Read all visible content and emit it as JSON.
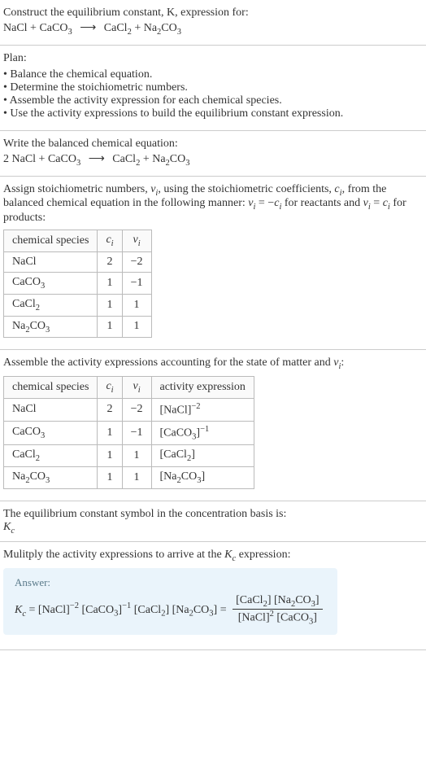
{
  "intro": {
    "line1": "Construct the equilibrium constant, K, expression for:",
    "eq_left": "NaCl + CaCO",
    "eq_left_sub": "3",
    "arrow": "⟶",
    "eq_right1": "CaCl",
    "eq_right1_sub": "2",
    "eq_plus": " + Na",
    "eq_right2_sub1": "2",
    "eq_right2": "CO",
    "eq_right2_sub2": "3"
  },
  "plan": {
    "header": "Plan:",
    "items": [
      "Balance the chemical equation.",
      "Determine the stoichiometric numbers.",
      "Assemble the activity expression for each chemical species.",
      "Use the activity expressions to build the equilibrium constant expression."
    ]
  },
  "balanced": {
    "header": "Write the balanced chemical equation:",
    "eq": "2 NaCl + CaCO3  ⟶  CaCl2 + Na2CO3"
  },
  "stoich_text": {
    "line1a": "Assign stoichiometric numbers, ν",
    "line1a_sub": "i",
    "line1b": ", using the stoichiometric coefficients, c",
    "line1b_sub": "i",
    "line1c": ", from the balanced chemical equation in the following manner: ν",
    "line1c_sub": "i",
    "line1d": " = −c",
    "line1d_sub": "i",
    "line1e": " for reactants and ν",
    "line1e_sub": "i",
    "line1f": " = c",
    "line1f_sub": "i",
    "line1g": " for products:"
  },
  "stoich_table": {
    "headers": [
      "chemical species",
      "cᵢ",
      "νᵢ"
    ],
    "rows": [
      {
        "species": "NaCl",
        "c": "2",
        "v": "−2"
      },
      {
        "species": "CaCO3",
        "c": "1",
        "v": "−1"
      },
      {
        "species": "CaCl2",
        "c": "1",
        "v": "1"
      },
      {
        "species": "Na2CO3",
        "c": "1",
        "v": "1"
      }
    ]
  },
  "activity_text": "Assemble the activity expressions accounting for the state of matter and νᵢ:",
  "activity_table": {
    "headers": [
      "chemical species",
      "cᵢ",
      "νᵢ",
      "activity expression"
    ],
    "rows": [
      {
        "species": "NaCl",
        "c": "2",
        "v": "−2",
        "expr": "[NaCl]^−2"
      },
      {
        "species": "CaCO3",
        "c": "1",
        "v": "−1",
        "expr": "[CaCO3]^−1"
      },
      {
        "species": "CaCl2",
        "c": "1",
        "v": "1",
        "expr": "[CaCl2]"
      },
      {
        "species": "Na2CO3",
        "c": "1",
        "v": "1",
        "expr": "[Na2CO3]"
      }
    ]
  },
  "kc_symbol": {
    "line1": "The equilibrium constant symbol in the concentration basis is:",
    "symbol": "K",
    "symbol_sub": "c"
  },
  "multiply": "Mulitply the activity expressions to arrive at the Kc expression:",
  "answer": {
    "label": "Answer:",
    "lhs": "Kc = [NaCl]^−2 [CaCO3]^−1 [CaCl2] [Na2CO3] = ",
    "frac_num": "[CaCl2] [Na2CO3]",
    "frac_den": "[NaCl]^2 [CaCO3]"
  },
  "chart_data": {
    "type": "table",
    "tables": [
      {
        "title": "Stoichiometric numbers",
        "columns": [
          "chemical species",
          "c_i",
          "ν_i"
        ],
        "rows": [
          [
            "NaCl",
            2,
            -2
          ],
          [
            "CaCO3",
            1,
            -1
          ],
          [
            "CaCl2",
            1,
            1
          ],
          [
            "Na2CO3",
            1,
            1
          ]
        ]
      },
      {
        "title": "Activity expressions",
        "columns": [
          "chemical species",
          "c_i",
          "ν_i",
          "activity expression"
        ],
        "rows": [
          [
            "NaCl",
            2,
            -2,
            "[NaCl]^-2"
          ],
          [
            "CaCO3",
            1,
            -1,
            "[CaCO3]^-1"
          ],
          [
            "CaCl2",
            1,
            1,
            "[CaCl2]"
          ],
          [
            "Na2CO3",
            1,
            1,
            "[Na2CO3]"
          ]
        ]
      }
    ]
  }
}
